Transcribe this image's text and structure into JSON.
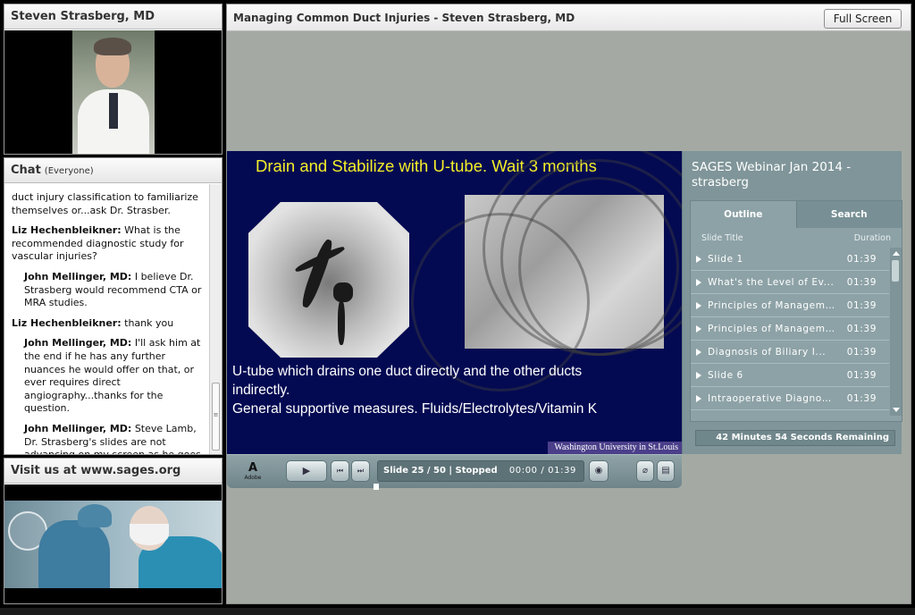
{
  "presenter_pod": {
    "title": "Steven Strasberg, MD"
  },
  "chat_pod": {
    "title": "Chat",
    "audience": "(Everyone)",
    "messages": [
      {
        "author": "",
        "text": "duct injury classification to familiarize themselves or...ask Dr. Strasber."
      },
      {
        "author": "Liz Hechenbleikner:",
        "text": "What is the recommended diagnostic study for vascular injuries?"
      },
      {
        "author": "John Mellinger, MD:",
        "text": "I believe Dr. Strasberg would recommend CTA or MRA studies."
      },
      {
        "author": "Liz Hechenbleikner:",
        "text": "thank you"
      },
      {
        "author": "John Mellinger, MD:",
        "text": "I'll ask him at the end if he has any further nuances he would offer on that, or ever requires direct angiography...thanks for the question."
      },
      {
        "author": "John Mellinger, MD:",
        "text": "Steve Lamb, Dr. Strasberg's slides are not advancing on my screen as he goes through his talk..."
      }
    ]
  },
  "visit_pod": {
    "title": "Visit us at www.sages.org"
  },
  "share_pod": {
    "title": "Managing Common Duct Injuries - Steven Strasberg, MD",
    "fullscreen_label": "Full Screen"
  },
  "slide": {
    "title": "Drain and Stabilize with U-tube. Wait 3 months",
    "line1": "U-tube which drains one duct directly and the other ducts",
    "line2": "indirectly.",
    "line3": "General supportive measures.  Fluids/Electrolytes/Vitamin K",
    "footer": "Washington University in St.Louis"
  },
  "sidebar": {
    "title": "SAGES Webinar Jan 2014 - strasberg",
    "tabs": [
      "Outline",
      "Search"
    ],
    "col_title": "Slide Title",
    "col_duration": "Duration",
    "rows": [
      {
        "title": "Slide 1",
        "duration": "01:39"
      },
      {
        "title": "What's the Level of Ev...",
        "duration": "01:39"
      },
      {
        "title": "Principles of Manageme...",
        "duration": "01:39"
      },
      {
        "title": "Principles of Manageme...",
        "duration": "01:39"
      },
      {
        "title": "Diagnosis of Biliary I...",
        "duration": "01:39"
      },
      {
        "title": "Slide 6",
        "duration": "01:39"
      },
      {
        "title": "Intraoperative Diagnos...",
        "duration": "01:39"
      }
    ],
    "remaining": "42 Minutes 54 Seconds Remaining"
  },
  "player": {
    "adobe_label": "Adobe",
    "status": "Slide 25 / 50 | Stopped",
    "time": "00:00 / 01:39",
    "progress_fraction": 0
  }
}
